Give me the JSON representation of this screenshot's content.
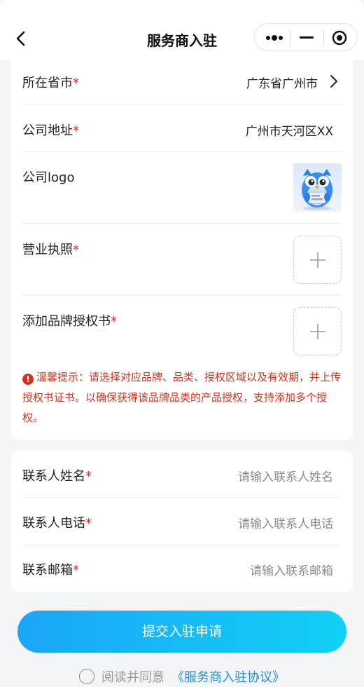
{
  "nav": {
    "title": "服务商入驻"
  },
  "form": {
    "province": {
      "label": "所在省市",
      "required": "*",
      "value": "广东省广州市"
    },
    "address": {
      "label": "公司地址",
      "required": "*",
      "value": "广州市天河区XX"
    },
    "logo": {
      "label": "公司logo"
    },
    "license": {
      "label": "营业执照",
      "required": "*"
    },
    "brand_auth": {
      "label": "添加品牌授权书",
      "required": "*"
    },
    "tip_icon": "!",
    "tip": "温馨提示：请选择对应品牌、品类、授权区域以及有效期，并上传授权书证书。以确保获得该品牌品类的产品授权，支持添加多个授权。"
  },
  "contact": {
    "name": {
      "label": "联系人姓名",
      "required": "*",
      "placeholder": "请输入联系人姓名"
    },
    "phone": {
      "label": "联系人电话",
      "required": "*",
      "placeholder": "请输入联系人电话"
    },
    "email": {
      "label": "联系邮箱",
      "required": "*",
      "placeholder": "请输入联系邮箱"
    }
  },
  "submit_label": "提交入驻申请",
  "agreement": {
    "text": "阅读并同意",
    "link": "《服务商入驻协议》"
  },
  "colors": {
    "required": "#e02e24",
    "tip": "#d2331f",
    "button_start": "#1aa6f7",
    "button_end": "#11d0f5",
    "link": "#1f8fe0"
  },
  "icons": [
    "back-arrow-icon",
    "more-dots-icon",
    "minimize-icon",
    "close-circle-icon",
    "chevron-right-icon",
    "plus-icon",
    "warning-icon",
    "radio-icon"
  ]
}
